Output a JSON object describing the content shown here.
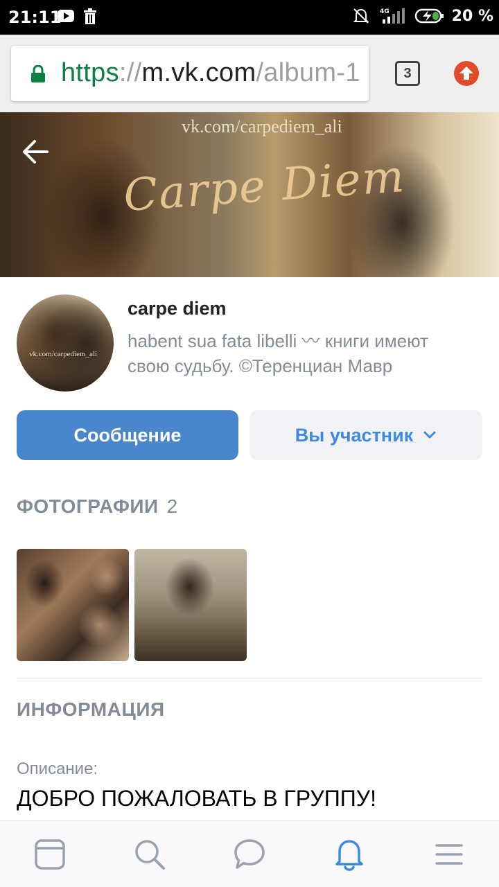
{
  "status_bar": {
    "time": "21:11",
    "network": "4G",
    "battery": "20 %"
  },
  "browser": {
    "url_scheme": "https",
    "url_separator": "://",
    "url_host": "m.vk.com",
    "url_path": "/album-1",
    "tab_count": "3"
  },
  "cover": {
    "watermark": "vk.com/carpediem_ali",
    "script_title": "Carpe Diem"
  },
  "group": {
    "avatar_text": "vk.com/carpediem_ali",
    "name": "carpe diem",
    "status": "habent sua fata libelli 〰 книги имеют свою судьбу. ©Теренциан Мавр",
    "message_button": "Сообщение",
    "member_button": "Вы участник"
  },
  "photos": {
    "title": "ФОТОГРАФИИ",
    "count": "2"
  },
  "info": {
    "title": "ИНФОРМАЦИЯ",
    "description_label": "Описание:",
    "description_text": "ДОБРО ПОЖАЛОВАТЬ В ГРУППУ!"
  },
  "colors": {
    "accent": "#4986cc",
    "link": "#3f8ae0",
    "muted": "#818c99",
    "secure_green": "#0b8043"
  },
  "bottom_nav": {
    "items": [
      "feed-icon",
      "search-icon",
      "messages-icon",
      "notifications-icon",
      "menu-icon"
    ],
    "active": "notifications-icon"
  }
}
